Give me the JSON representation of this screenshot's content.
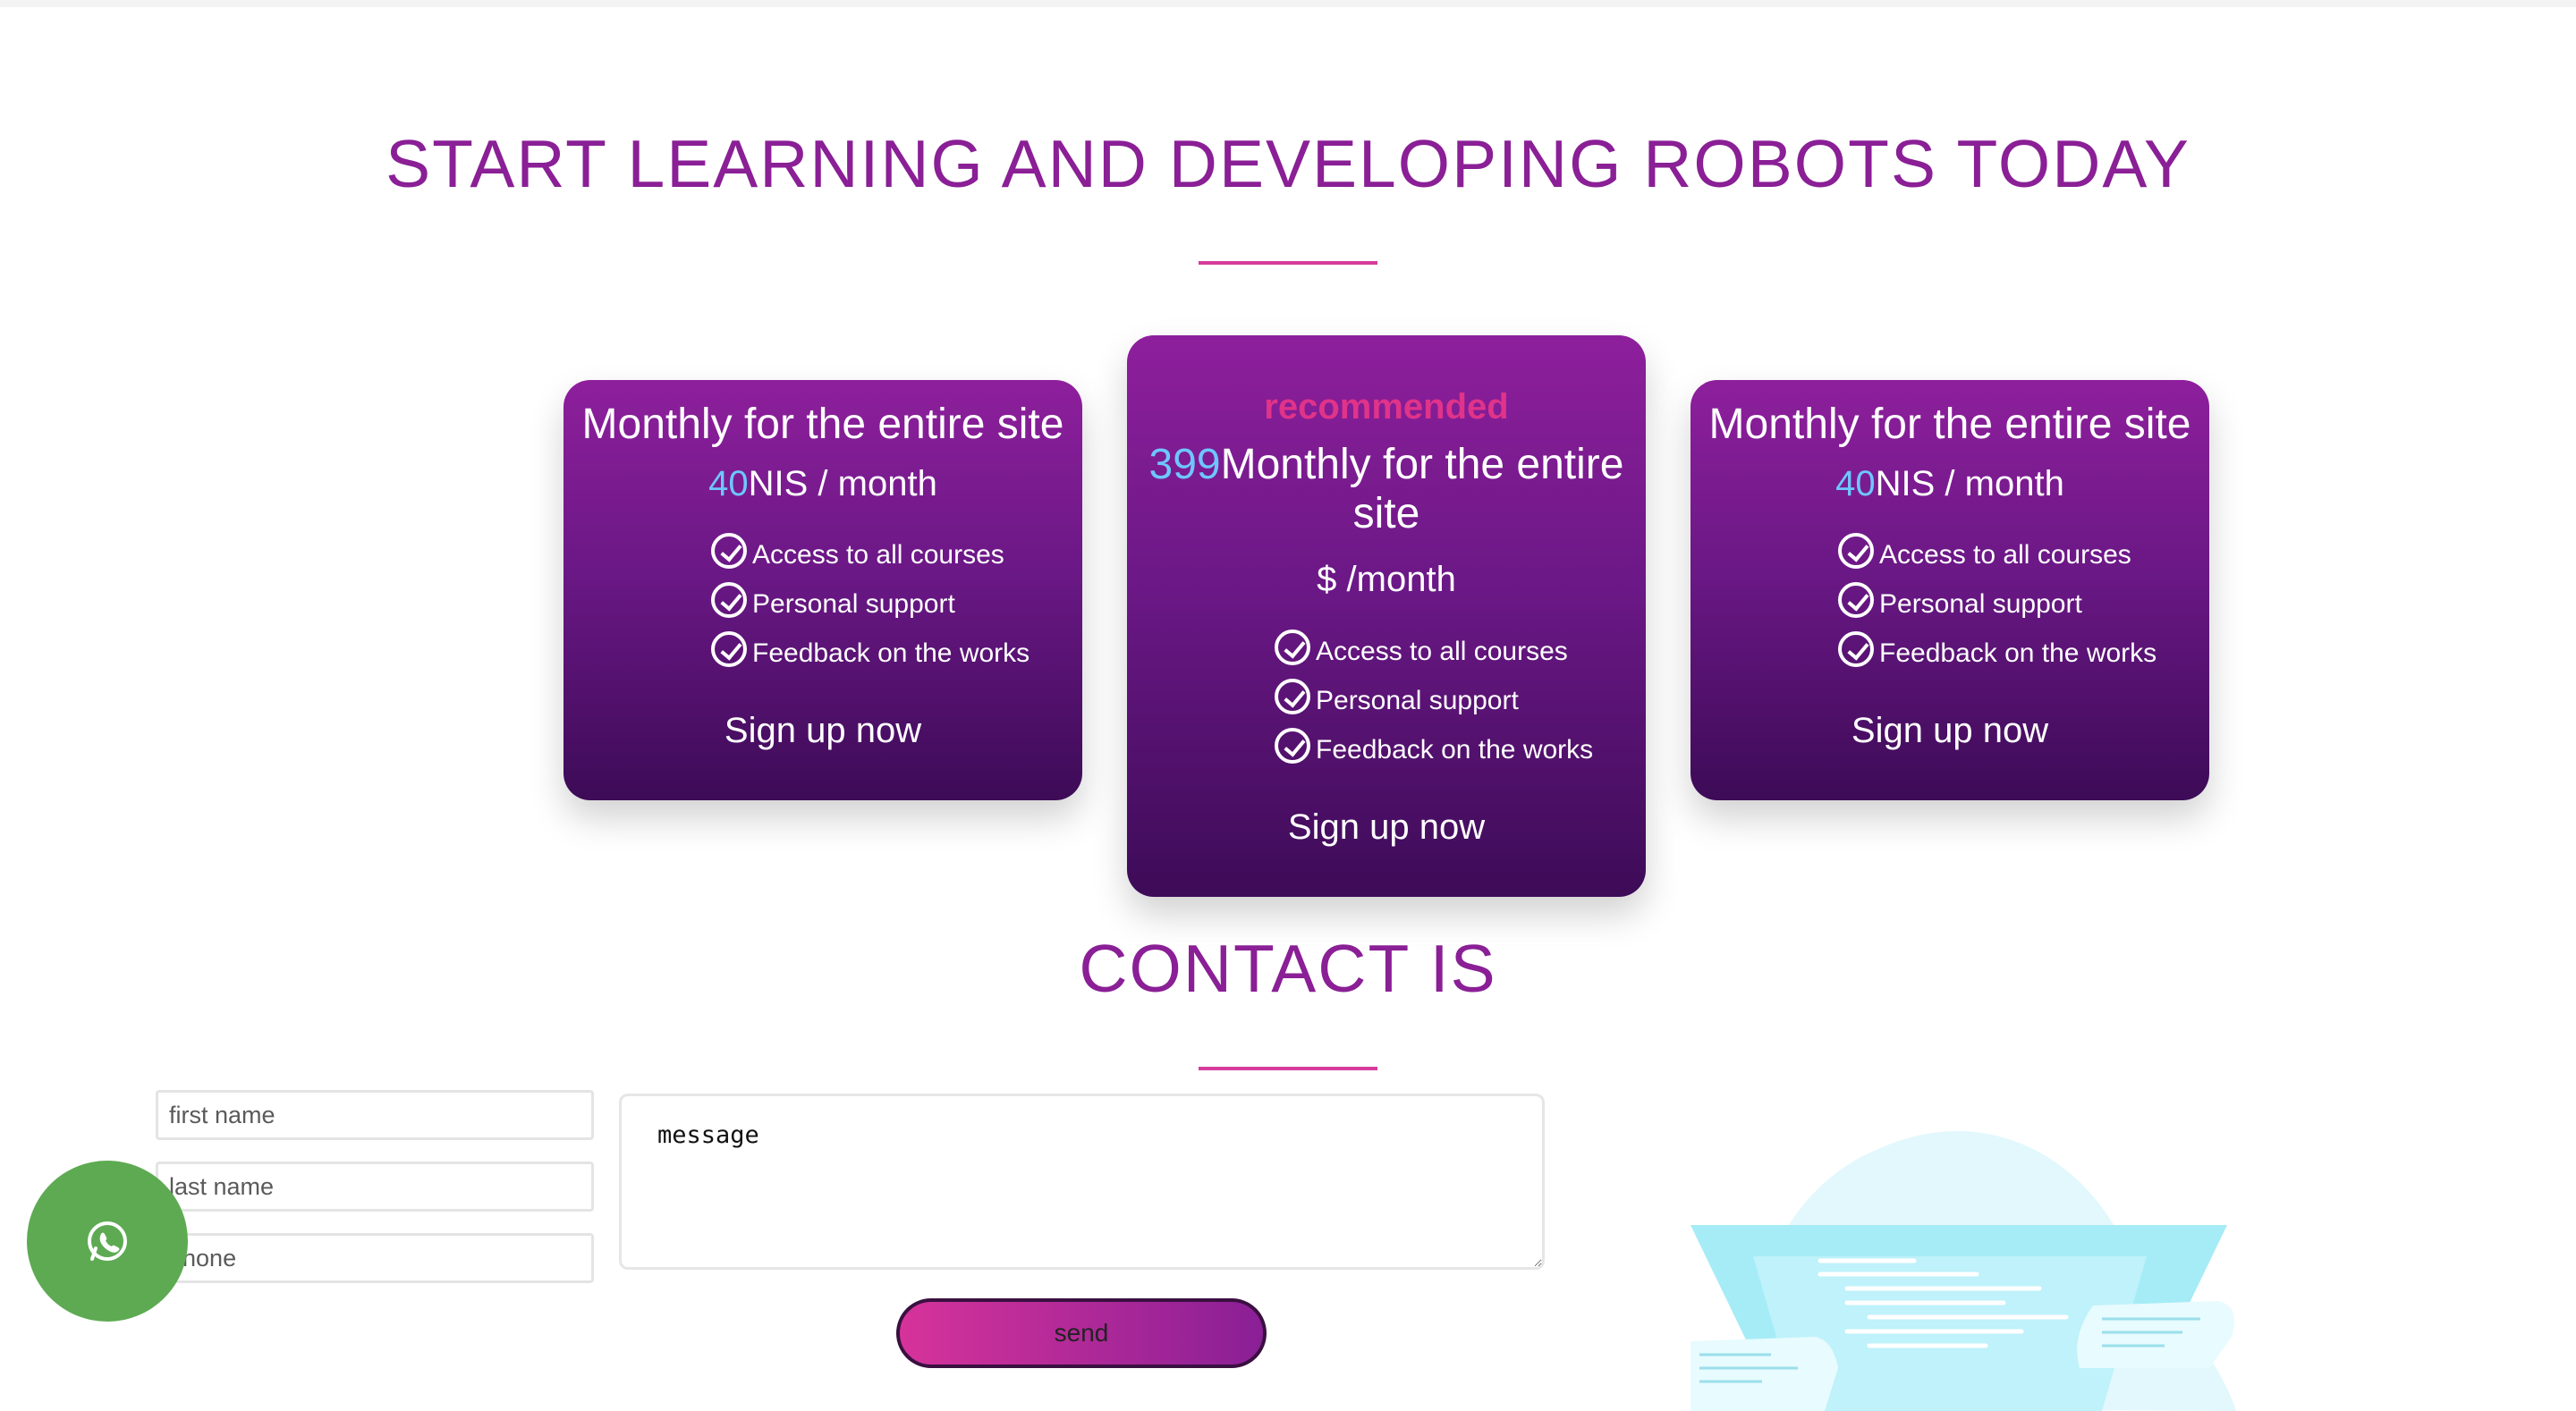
{
  "hero": {
    "title": "START LEARNING AND DEVELOPING ROBOTS TODAY"
  },
  "plans": [
    {
      "title": "Monthly for the entire site",
      "price": "40",
      "unit": "NIS / month",
      "features": [
        "Access to all courses",
        "Personal support",
        "Feedback on the works"
      ],
      "cta": "Sign up now"
    },
    {
      "badge": "recommended",
      "price": "399",
      "title": "Monthly for the entire site",
      "unit": "$ /month",
      "features": [
        "Access to all courses",
        "Personal support",
        "Feedback on the works"
      ],
      "cta": "Sign up now"
    },
    {
      "title": "Monthly for the entire site",
      "price": "40",
      "unit": "NIS / month",
      "features": [
        "Access to all courses",
        "Personal support",
        "Feedback on the works"
      ],
      "cta": "Sign up now"
    }
  ],
  "contact": {
    "title": "CONTACT IS",
    "first_name_placeholder": "first name",
    "last_name_placeholder": "last name",
    "phone_placeholder": "phone",
    "message_placeholder": "message",
    "send_label": "send"
  },
  "colors": {
    "accent": "#8a1f96",
    "underline": "#d63c9b",
    "price": "#6ec6ff",
    "badge": "#e0338a",
    "whatsapp": "#5daa52"
  },
  "icons": {
    "check": "check-circle-icon",
    "chat": "whatsapp-icon"
  }
}
